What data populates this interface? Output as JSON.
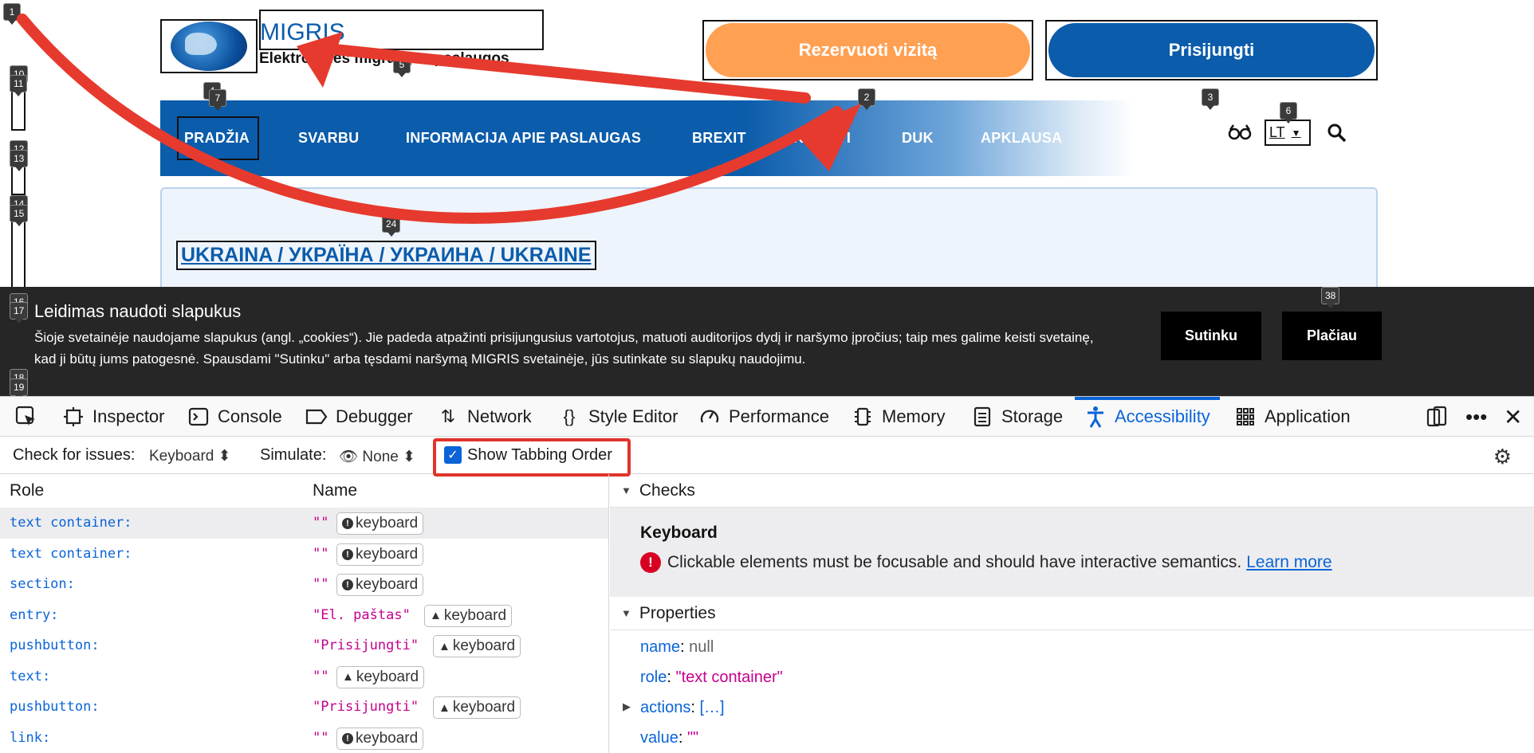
{
  "site": {
    "brand_title": "MIGRIS",
    "brand_subtitle": "Elektroninės migracijos paslaugos",
    "btn_book": "Rezervuoti vizitą",
    "btn_login": "Prisijungti",
    "nav": [
      "PRADŽIA",
      "SVARBU",
      "INFORMACIJA APIE PASLAUGAS",
      "BREXIT",
      "KVIESTI",
      "DUK",
      "APKLAUSA"
    ],
    "lang": "LT",
    "headline": "UKRAINA / УКРАЇНА / УКРАИНА / UKRAINE",
    "cookie": {
      "title": "Leidimas naudoti slapukus",
      "text": "Šioje svetainėje naudojame slapukus (angl. „cookies“). Jie padeda atpažinti prisijungusius vartotojus, matuoti auditorijos dydį ir naršymo įpročius; taip mes galime keisti svetainę, kad ji būtų jums patogesnė. Spausdami \"Sutinku\" arba tęsdami naršymą MIGRIS svetainėje, jūs sutinkate su slapukų naudojimu.",
      "accept": "Sutinku",
      "more": "Plačiau"
    },
    "badges": {
      "b1": "1",
      "b2": "2",
      "b3": "3",
      "b4": "4",
      "b5": "5",
      "b6": "6",
      "b7": "7",
      "b10": "10",
      "b11": "11",
      "b12": "12",
      "b13": "13",
      "b14": "14",
      "b15": "15",
      "b16": "16",
      "b17": "17",
      "b18": "18",
      "b19": "19",
      "b24": "24",
      "b38": "38"
    }
  },
  "devtools": {
    "tabs": [
      "Inspector",
      "Console",
      "Debugger",
      "Network",
      "Style Editor",
      "Performance",
      "Memory",
      "Storage",
      "Accessibility",
      "Application"
    ],
    "active_tab": "Accessibility",
    "toolbar": {
      "check_label": "Check for issues:",
      "check_value": "Keyboard",
      "simulate_label": "Simulate:",
      "simulate_value": "None",
      "show_tabbing": "Show Tabbing Order"
    },
    "tree": {
      "col_role": "Role",
      "col_name": "Name",
      "rows": [
        {
          "role": "text container:",
          "name": "\"\"",
          "badge": "keyboard",
          "level": "error"
        },
        {
          "role": "text container:",
          "name": "\"\"",
          "badge": "keyboard",
          "level": "error"
        },
        {
          "role": "section:",
          "name": "\"\"",
          "badge": "keyboard",
          "level": "error"
        },
        {
          "role": "entry:",
          "name": "\"El. paštas\"",
          "badge": "keyboard",
          "level": "warning"
        },
        {
          "role": "pushbutton:",
          "name": "\"Prisijungti\"",
          "badge": "keyboard",
          "level": "warning"
        },
        {
          "role": "text:",
          "name": "\"\"",
          "badge": "keyboard",
          "level": "warning"
        },
        {
          "role": "pushbutton:",
          "name": "\"Prisijungti\"",
          "badge": "keyboard",
          "level": "warning"
        },
        {
          "role": "link:",
          "name": "\"\"",
          "badge": "keyboard",
          "level": "error"
        }
      ]
    },
    "checks": {
      "section": "Checks",
      "title": "Keyboard",
      "message": "Clickable elements must be focusable and should have interactive semantics.",
      "learn_more": "Learn more"
    },
    "properties": {
      "section": "Properties",
      "items": [
        {
          "key": "name",
          "value": "null"
        },
        {
          "key": "role",
          "value": "\"text container\""
        },
        {
          "key": "actions",
          "value": "[…]"
        },
        {
          "key": "value",
          "value": "\"\""
        }
      ]
    }
  }
}
